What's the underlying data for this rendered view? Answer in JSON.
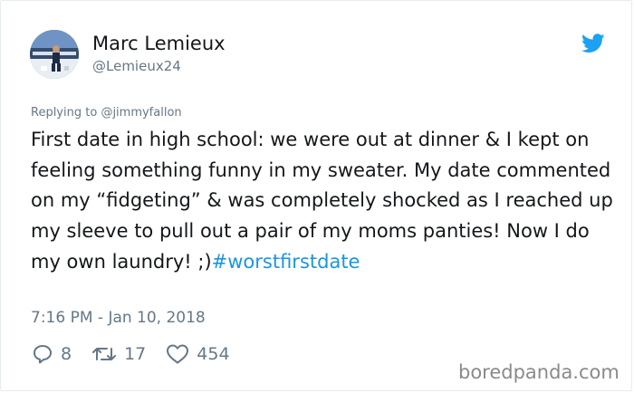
{
  "author": {
    "name": "Marc Lemieux",
    "handle": "@Lemieux24",
    "avatar_icon": "avatar-photo-skater"
  },
  "platform_icon": "twitter-bird-icon",
  "accent_color": "#1b95e0",
  "reply": {
    "label": "Replying to",
    "to": "@jimmyfallon"
  },
  "tweet": {
    "text": "First date in high school: we were out at dinner & I kept on feeling something funny in my sweater. My date commented on my “fidgeting” & was completely shocked as I reached up my sleeve to pull out a pair of my moms panties!  Now I do my own laundry! ;)",
    "hashtag": "#worstfirstdate",
    "timestamp": "7:16 PM - Jan 10, 2018"
  },
  "actions": {
    "replies": "8",
    "retweets": "17",
    "likes": "454"
  },
  "watermark": "boredpanda.com"
}
